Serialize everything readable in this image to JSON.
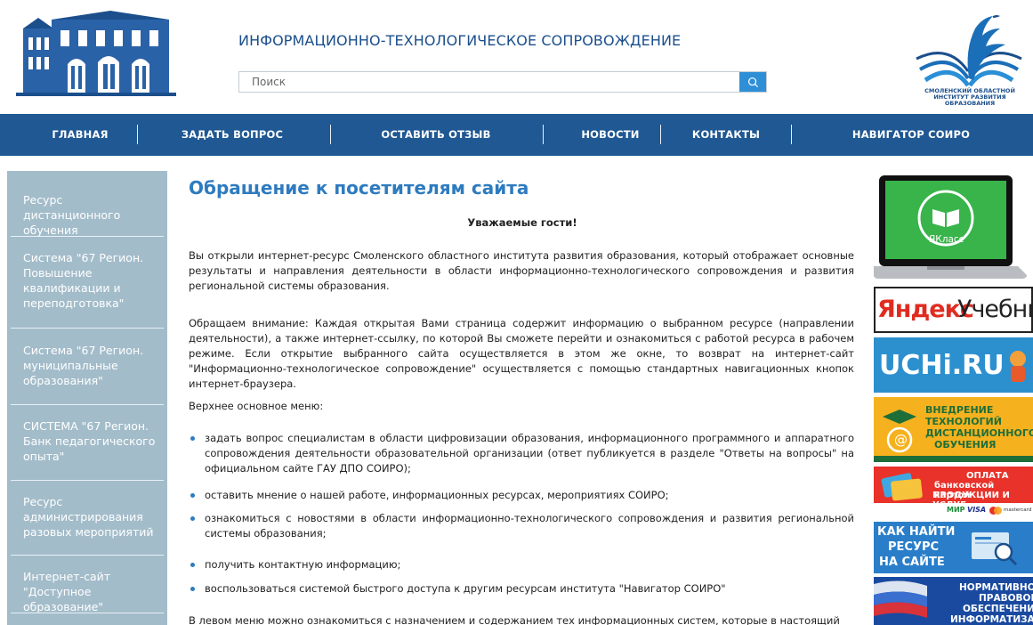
{
  "header": {
    "title": "ИНФОРМАЦИОННО-ТЕХНОЛОГИЧЕСКОЕ СОПРОВОЖДЕНИЕ",
    "search_placeholder": "Поиск",
    "right_logo_text": "СМОЛЕНСКИЙ ОБЛАСТНОЙ ИНСТИТУТ РАЗВИТИЯ ОБРАЗОВАНИЯ"
  },
  "nav": {
    "items": [
      {
        "label": "ГЛАВНАЯ"
      },
      {
        "label": "ЗАДАТЬ ВОПРОС"
      },
      {
        "label": "ОСТАВИТЬ ОТЗЫВ"
      },
      {
        "label": "НОВОСТИ"
      },
      {
        "label": "КОНТАКТЫ"
      },
      {
        "label": "НАВИГАТОР СОИРО"
      }
    ]
  },
  "sidebar": {
    "items": [
      {
        "label": "Ресурс дистанционного обучения"
      },
      {
        "label": "Система \"67 Регион. Повышение квалификации и переподготовка\""
      },
      {
        "label": "Система \"67 Регион. муниципальные образования\""
      },
      {
        "label": "СИСТЕМА \"67 Регион. Банк педагогического опыта\""
      },
      {
        "label": "Ресурс администрирования разовых мероприятий"
      },
      {
        "label": "Интернет-сайт \"Доступное образование\""
      }
    ]
  },
  "main": {
    "title": "Обращение к посетителям сайта",
    "greeting": "Уважаемые гости!",
    "p1": "Вы открыли интернет-ресурс Смоленского областного института развития образования, который отображает основные результаты и направления деятельности в области информационно-технологического сопровождения и развития региональной системы образования.",
    "p2": "Обращаем внимание: Каждая открытая Вами страница содержит информацию о выбранном ресурсе (направлении деятельности), а также интернет-ссылку, по которой Вы сможете перейти и ознакомиться с работой ресурса в рабочем режиме. Если открытие выбранного сайта осуществляется в этом же окне, то возврат на интернет-сайт \"Информационно-технологическое сопровождение\" осуществляется с помощью стандартных навигационных кнопок интернет-браузера.",
    "menu_heading": "Верхнее основное меню:",
    "bullets": [
      "задать вопрос специалистам в области цифровизации образования, информационного программного и аппаратного сопровождения деятельности образовательной организации (ответ публикуется в разделе \"Ответы на вопросы\" на официальном сайте ГАУ ДПО СОИРО);",
      "оставить мнение о нашей работе, информационных ресурсах, мероприятиях СОИРО;",
      "ознакомиться с новостями в области информационно-технологического сопровождения и развития региональной системы образования;",
      "получить контактную информацию;",
      "воспользоваться системой быстрого доступа к другим ресурсам института \"Навигатор СОИРО\""
    ],
    "p3": "В левом меню можно ознакомиться с назначением и содержанием тех информационных систем, которые в настоящий"
  },
  "banners": {
    "yaklass": "ЯКласс",
    "yandex_1": "Яндекс",
    "yandex_2": "Учебник",
    "uchi": "UCHi.RU",
    "distance_1": "ВНЕДРЕНИЕ",
    "distance_2": "ТЕХНОЛОГИЙ",
    "distance_3": "ДИСТАНЦИОННОГО",
    "distance_4": "ОБУЧЕНИЯ",
    "pay_1": "ОПЛАТА",
    "pay_2": "банковской картой",
    "pay_3": "ПРОДУКЦИИ И УСЛУГ",
    "pay_cards_1": "МИР",
    "pay_cards_2": "VISA",
    "pay_cards_3": "mastercard",
    "find_1": "КАК НАЙТИ",
    "find_2": "РЕСУРС",
    "find_3": "НА САЙТЕ",
    "norm_1": "НОРМАТИВНО-",
    "norm_2": "ПРАВОВОЕ",
    "norm_3": "ОБЕСПЕЧЕНИЕ",
    "norm_4": "ИНФОРМАТИЗАЦИИ"
  },
  "colors": {
    "nav_bg": "#1f5893",
    "sidebar_bg": "#a3bcca",
    "title_blue": "#2e7bbf",
    "search_btn": "#2f8fd6"
  }
}
